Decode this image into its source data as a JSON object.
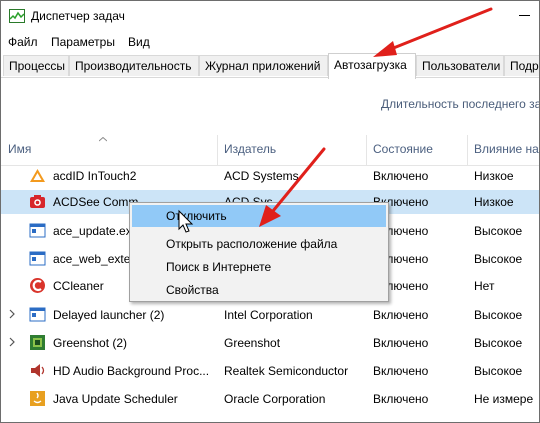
{
  "window": {
    "title": "Диспетчер задач",
    "icon": "task-manager-icon"
  },
  "menu": [
    "Файл",
    "Параметры",
    "Вид"
  ],
  "tabs": [
    {
      "label": "Процессы"
    },
    {
      "label": "Производительность"
    },
    {
      "label": "Журнал приложений"
    },
    {
      "label": "Автозагрузка",
      "active": true
    },
    {
      "label": "Пользователи"
    },
    {
      "label": "Подр"
    }
  ],
  "duration_label": "Длительность последнего за",
  "columns": {
    "name": "Имя",
    "publisher": "Издатель",
    "status": "Состояние",
    "impact": "Влияние на"
  },
  "rows": [
    {
      "name": "acdID InTouch2",
      "publisher": "ACD Systems",
      "status": "Включено",
      "impact": "Низкое",
      "icon": "acd-intouch-icon"
    },
    {
      "name": "ACDSee Comm",
      "publisher": "ACD Sys",
      "status": "Включено",
      "impact": "Низкое",
      "icon": "acdsee-camera-icon"
    },
    {
      "name": "ace_update.exe",
      "publisher": "",
      "status": "Включено",
      "impact": "Высокое",
      "icon": "exe-window-icon"
    },
    {
      "name": "ace_web_exten",
      "publisher": "",
      "status": "Включено",
      "impact": "Высокое",
      "icon": "exe-window-icon"
    },
    {
      "name": "CCleaner",
      "publisher": "",
      "status": "Включено",
      "impact": "Нет",
      "icon": "ccleaner-icon"
    },
    {
      "name": "Delayed launcher (2)",
      "publisher": "Intel Corporation",
      "status": "Включено",
      "impact": "Высокое",
      "icon": "exe-window-icon"
    },
    {
      "name": "Greenshot (2)",
      "publisher": "Greenshot",
      "status": "Включено",
      "impact": "Высокое",
      "icon": "greenshot-icon"
    },
    {
      "name": "HD Audio Background Proc...",
      "publisher": "Realtek Semiconductor",
      "status": "Включено",
      "impact": "Высокое",
      "icon": "speaker-icon"
    },
    {
      "name": "Java Update Scheduler",
      "publisher": "Oracle Corporation",
      "status": "Включено",
      "impact": "Не измере",
      "icon": "java-icon"
    }
  ],
  "context_menu": [
    "Отключить",
    "Открыть расположение файла",
    "Поиск в Интернете",
    "Свойства"
  ],
  "colors": {
    "selected_row": "#cce4f7",
    "menu_highlight": "#91c9f7",
    "arrow": "#e0201b",
    "header_text": "#4c6080"
  }
}
